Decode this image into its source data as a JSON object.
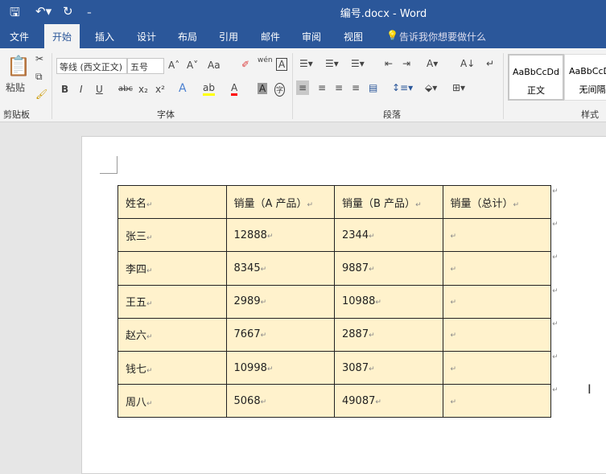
{
  "window": {
    "title": "编号.docx  -  Word"
  },
  "quick_access": {
    "save": "save-icon",
    "undo": "undo-icon",
    "redo": "redo-icon",
    "customize": "customize-icon"
  },
  "tabs": [
    {
      "label": "文件"
    },
    {
      "label": "开始",
      "active": true
    },
    {
      "label": "插入"
    },
    {
      "label": "设计"
    },
    {
      "label": "布局"
    },
    {
      "label": "引用"
    },
    {
      "label": "邮件"
    },
    {
      "label": "审阅"
    },
    {
      "label": "视图"
    }
  ],
  "tell_me": "告诉我你想要做什么",
  "ribbon": {
    "clipboard": {
      "paste": "粘贴",
      "group": "剪贴板"
    },
    "font": {
      "name": "等线 (西文正文)",
      "size": "五号",
      "group": "字体",
      "case": "Aa",
      "bold": "B",
      "italic": "I",
      "underline": "U",
      "strike": "abc",
      "sub": "x₂",
      "sup": "x²",
      "font_color": "#ff0000",
      "highlight_color": "#ffff00",
      "char_border": "A",
      "wen": "wén",
      "enclose": "字"
    },
    "paragraph": {
      "group": "段落"
    },
    "styles": {
      "group": "样式",
      "items": [
        {
          "preview": "AaBbCcDd",
          "name": "正文"
        },
        {
          "preview": "AaBbCcDd",
          "name": "无间隔"
        }
      ]
    }
  },
  "table": {
    "header": [
      "姓名",
      "销量（A 产品）",
      "销量（B 产品）",
      "销量（总计）"
    ],
    "rows": [
      [
        "张三",
        "12888",
        "2344",
        ""
      ],
      [
        "李四",
        "8345",
        "9887",
        ""
      ],
      [
        "王五",
        "2989",
        "10988",
        ""
      ],
      [
        "赵六",
        "7667",
        "2887",
        ""
      ],
      [
        "钱七",
        "10998",
        "3087",
        ""
      ],
      [
        "周八",
        "5068",
        "49087",
        ""
      ]
    ],
    "cell_color": "#fff2cc"
  },
  "mark": "↵"
}
